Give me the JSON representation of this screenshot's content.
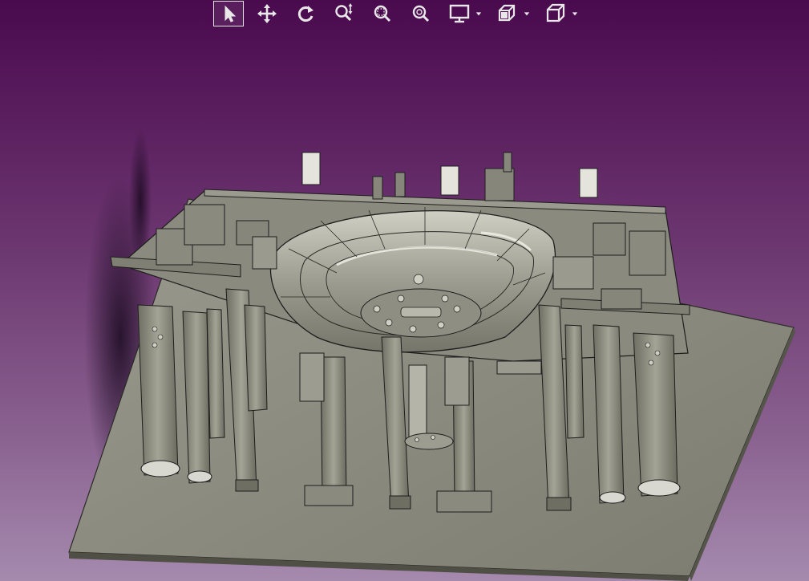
{
  "toolbar": {
    "buttons": [
      {
        "id": "select",
        "icon": "pointer-arrow-icon",
        "active": true
      },
      {
        "id": "pan",
        "icon": "move-arrows-icon",
        "active": false
      },
      {
        "id": "rotate",
        "icon": "rotate-icon",
        "active": false
      },
      {
        "id": "zoom-in-out",
        "icon": "zoom-in-out-icon",
        "active": false
      },
      {
        "id": "zoom-window",
        "icon": "zoom-window-icon",
        "active": false
      },
      {
        "id": "zoom-all",
        "icon": "zoom-all-icon",
        "active": false
      },
      {
        "id": "display-mode",
        "icon": "monitor-icon",
        "active": false,
        "has_menu": true
      },
      {
        "id": "section",
        "icon": "section-plane-icon",
        "active": false,
        "has_menu": true
      },
      {
        "id": "view-orientation",
        "icon": "cube-view-icon",
        "active": false,
        "has_menu": true
      }
    ],
    "icon_color": "#e8e8e8"
  },
  "viewport": {
    "background_top": "#4a0a4e",
    "background_bottom": "#a58aae",
    "model_color": "#8d8d80",
    "edge_color": "#1e1e1e"
  }
}
